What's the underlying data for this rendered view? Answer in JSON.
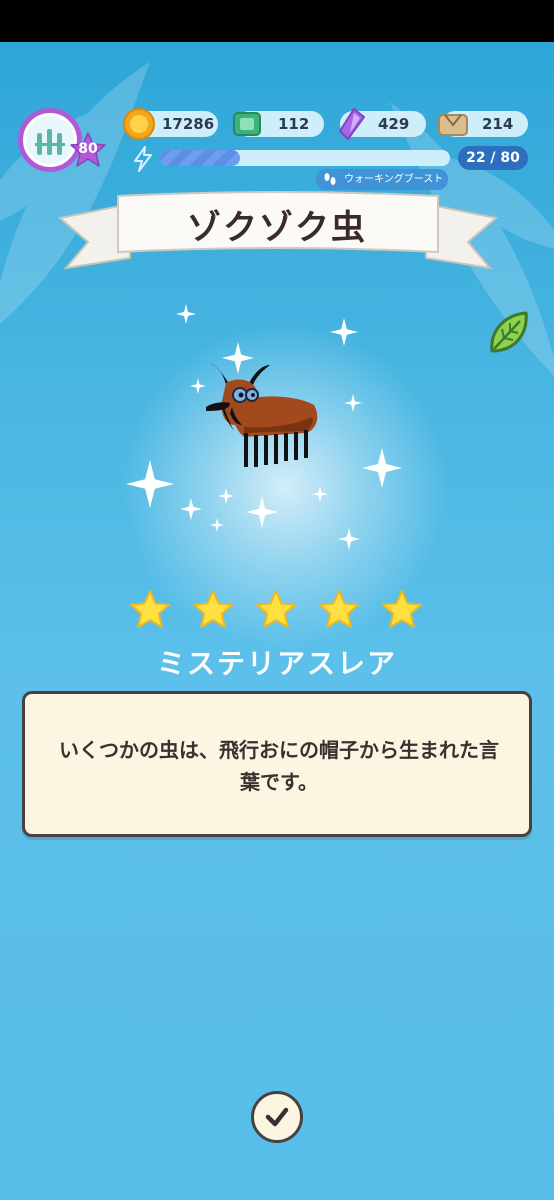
{
  "status_bar": {},
  "player": {
    "level": "80"
  },
  "currencies": [
    {
      "name": "coin",
      "icon": "coin-icon",
      "value": "17286"
    },
    {
      "name": "ticket",
      "icon": "ticket-icon",
      "value": "112"
    },
    {
      "name": "crystal",
      "icon": "crystal-icon",
      "value": "429"
    },
    {
      "name": "material",
      "icon": "parcel-icon",
      "value": "214"
    }
  ],
  "energy": {
    "current": 22,
    "max": 80,
    "label": "22 / 80",
    "fraction": 0.275
  },
  "boost": {
    "label": "ウォーキングブースト",
    "icon": "footprints-icon"
  },
  "creature": {
    "name": "ゾクゾク虫",
    "stars": 5,
    "rarity": "ミステリアスレア"
  },
  "description": "いくつかの虫は、飛行おにの帽子から生まれた言葉です。",
  "buttons": {
    "confirm_icon": "checkmark-icon",
    "leaf_icon": "leaf-icon"
  },
  "colors": {
    "accent_purple": "#b05ad8",
    "star_yellow": "#ffe042",
    "sky_blue": "#49b6e2",
    "card_bg": "#fbf6e2"
  }
}
